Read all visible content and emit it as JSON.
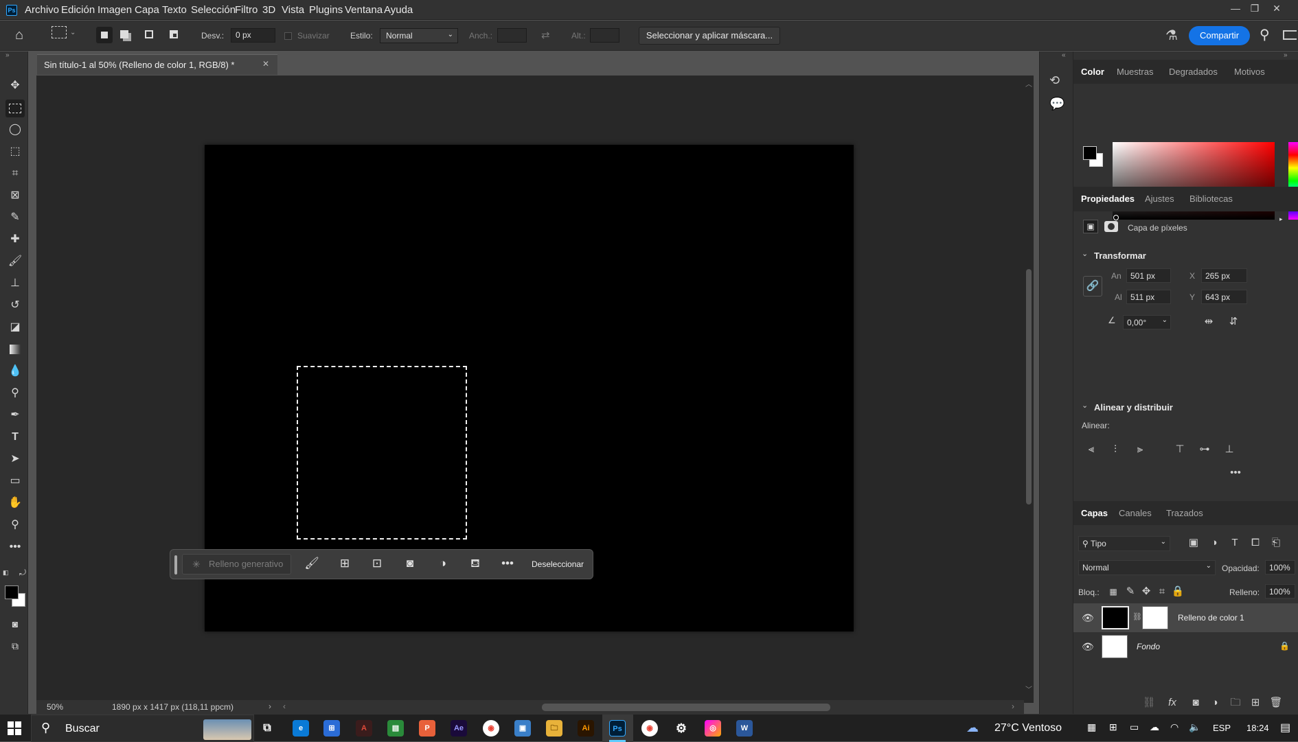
{
  "menubar": {
    "items": [
      "Archivo",
      "Edición",
      "Imagen",
      "Capa",
      "Texto",
      "Selección",
      "Filtro",
      "3D",
      "Vista",
      "Plugins",
      "Ventana",
      "Ayuda"
    ]
  },
  "options": {
    "feather_label": "Desv.:",
    "feather_value": "0 px",
    "antialias_label": "Suavizar",
    "style_label": "Estilo:",
    "style_value": "Normal",
    "width_label": "Anch.:",
    "height_label": "Alt.:",
    "select_mask_label": "Seleccionar y aplicar máscara...",
    "share_label": "Compartir"
  },
  "document": {
    "tab_title": "Sin título-1 al 50% (Relleno de color 1, RGB/8) *",
    "zoom": "50%",
    "size_info": "1890 px x 1417 px (118,11 ppcm)"
  },
  "context_bar": {
    "generative_fill": "Relleno generativo",
    "deselect": "Deseleccionar"
  },
  "color_panel": {
    "tabs": [
      "Color",
      "Muestras",
      "Degradados",
      "Motivos"
    ],
    "foreground": "#000000",
    "background": "#ffffff"
  },
  "properties": {
    "tabs": [
      "Propiedades",
      "Ajustes",
      "Bibliotecas"
    ],
    "layer_type": "Capa de píxeles",
    "transform_header": "Transformar",
    "w_label": "An",
    "w_value": "501 px",
    "h_label": "Al",
    "h_value": "511 px",
    "x_label": "X",
    "x_value": "265 px",
    "y_label": "Y",
    "y_value": "643 px",
    "angle_value": "0,00°",
    "align_header": "Alinear y distribuir",
    "align_label": "Alinear:"
  },
  "layers": {
    "tabs": [
      "Capas",
      "Canales",
      "Trazados"
    ],
    "filter_value": "Tipo",
    "blend_mode": "Normal",
    "opacity_label": "Opacidad:",
    "opacity_value": "100%",
    "lock_label": "Bloq.:",
    "fill_label": "Relleno:",
    "fill_value": "100%",
    "items": [
      {
        "name": "Relleno de color 1"
      },
      {
        "name": "Fondo"
      }
    ]
  },
  "taskbar": {
    "search_placeholder": "Buscar",
    "weather": "27°C  Ventoso",
    "language": "ESP",
    "time": "18:24"
  }
}
